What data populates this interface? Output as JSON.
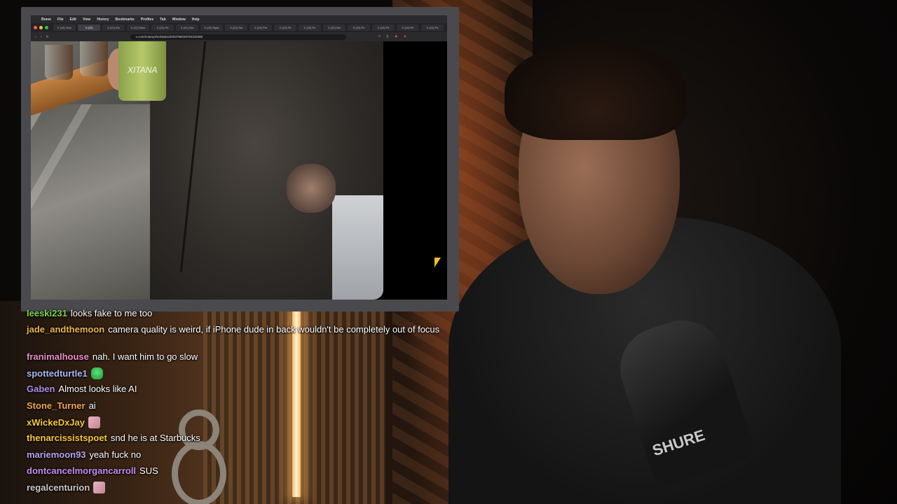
{
  "browser": {
    "menu_items": [
      "Brave",
      "File",
      "Edit",
      "View",
      "History",
      "Bookmarks",
      "Profiles",
      "Tab",
      "Window",
      "Help"
    ],
    "tabs": [
      "X (18) Hom",
      "X (22)",
      "X (21) Elo",
      "X (21) Mom",
      "X (21) Pe",
      "X (21) Grk",
      "X (22) Ryan",
      "X (22) Sai",
      "X (22) Pol",
      "X (22) Pe",
      "X (22) Pe",
      "X (22) Wo",
      "X (22) Pe",
      "X (22) Pe",
      "X (22) Pe",
      "X (22) Pe"
    ],
    "url": "x.com/notanyshulstatus/2003786026764232360",
    "drink_label": "XITANA"
  },
  "chat": {
    "messages": [
      {
        "user": "leeski231",
        "color": "#7fd64a",
        "text": "looks fake to me too"
      },
      {
        "user": "jade_andthemoon",
        "color": "#e8b64f",
        "text": "camera quality is weird, if iPhone dude in back wouldn't be completely out of focus"
      },
      {
        "user": "franimalhouse",
        "color": "#e98cc8",
        "text": "nah. I want him to go slow"
      },
      {
        "user": "spottedturtle1",
        "color": "#a8b6f0",
        "text": ""
      },
      {
        "user": "Gaben",
        "color": "#b18de6",
        "text": "Almost looks like AI"
      },
      {
        "user": "Stone_Turner",
        "color": "#f3a64a",
        "text": "ai"
      },
      {
        "user": "xWickeDxJay",
        "color": "#f6c93a",
        "text": ""
      },
      {
        "user": "thenarcissistspoet",
        "color": "#f6c93a",
        "text": "snd he is at Starbucks"
      },
      {
        "user": "mariemoon93",
        "color": "#b5a3f0",
        "text": "yeah fuck no"
      },
      {
        "user": "dontcancelmorgancarroll",
        "color": "#c68bf0",
        "text": "SUS"
      },
      {
        "user": "regalcenturion",
        "color": "#c8c8c8",
        "text": ""
      }
    ]
  },
  "overlay": {
    "mic_brand": "SHURE"
  }
}
